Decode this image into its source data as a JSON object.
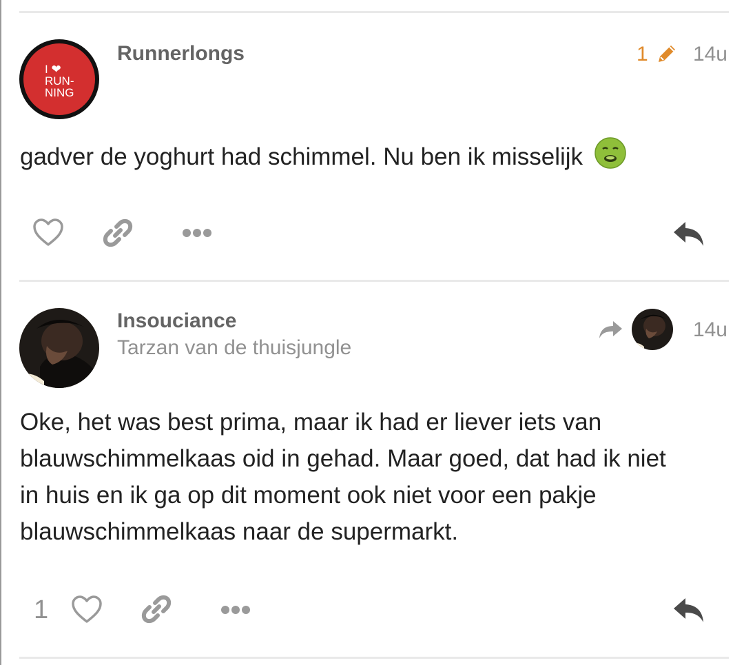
{
  "posts": [
    {
      "username": "Runnerlongs",
      "avatar_text": [
        "I ❤",
        "RUN-",
        "NING"
      ],
      "edit_count": "1",
      "time": "14u",
      "body": "gadver de yoghurt had schimmel. Nu ben ik misselijk",
      "emoji": "nauseated-face",
      "icons": [
        "heart-icon",
        "link-icon",
        "more-icon",
        "reply-icon"
      ]
    },
    {
      "username": "Insouciance",
      "user_title": "Tarzan van de thuisjungle",
      "time": "14u",
      "body_lines": [
        "Oke, het was best prima, maar ik had er liever iets van",
        "blauwschimmelkaas oid in gehad. Maar goed, dat had ik niet",
        "in huis en ik ga op dit moment ook niet voor een pakje",
        "blauwschimmelkaas naar de supermarkt."
      ],
      "like_count": "1",
      "icons": [
        "reply-to-icon",
        "heart-icon",
        "link-icon",
        "more-icon",
        "reply-icon"
      ]
    }
  ],
  "colors": {
    "accent_edit": "#e08a2a",
    "muted": "#919191",
    "avatar_red": "#d32f2f"
  }
}
